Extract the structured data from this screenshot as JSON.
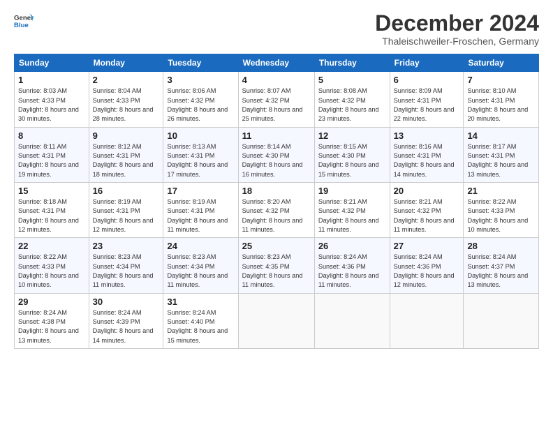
{
  "header": {
    "logo_line1": "General",
    "logo_line2": "Blue",
    "month": "December 2024",
    "location": "Thaleischweiler-Froschen, Germany"
  },
  "weekdays": [
    "Sunday",
    "Monday",
    "Tuesday",
    "Wednesday",
    "Thursday",
    "Friday",
    "Saturday"
  ],
  "weeks": [
    [
      {
        "day": "1",
        "sunrise": "Sunrise: 8:03 AM",
        "sunset": "Sunset: 4:33 PM",
        "daylight": "Daylight: 8 hours and 30 minutes."
      },
      {
        "day": "2",
        "sunrise": "Sunrise: 8:04 AM",
        "sunset": "Sunset: 4:33 PM",
        "daylight": "Daylight: 8 hours and 28 minutes."
      },
      {
        "day": "3",
        "sunrise": "Sunrise: 8:06 AM",
        "sunset": "Sunset: 4:32 PM",
        "daylight": "Daylight: 8 hours and 26 minutes."
      },
      {
        "day": "4",
        "sunrise": "Sunrise: 8:07 AM",
        "sunset": "Sunset: 4:32 PM",
        "daylight": "Daylight: 8 hours and 25 minutes."
      },
      {
        "day": "5",
        "sunrise": "Sunrise: 8:08 AM",
        "sunset": "Sunset: 4:32 PM",
        "daylight": "Daylight: 8 hours and 23 minutes."
      },
      {
        "day": "6",
        "sunrise": "Sunrise: 8:09 AM",
        "sunset": "Sunset: 4:31 PM",
        "daylight": "Daylight: 8 hours and 22 minutes."
      },
      {
        "day": "7",
        "sunrise": "Sunrise: 8:10 AM",
        "sunset": "Sunset: 4:31 PM",
        "daylight": "Daylight: 8 hours and 20 minutes."
      }
    ],
    [
      {
        "day": "8",
        "sunrise": "Sunrise: 8:11 AM",
        "sunset": "Sunset: 4:31 PM",
        "daylight": "Daylight: 8 hours and 19 minutes."
      },
      {
        "day": "9",
        "sunrise": "Sunrise: 8:12 AM",
        "sunset": "Sunset: 4:31 PM",
        "daylight": "Daylight: 8 hours and 18 minutes."
      },
      {
        "day": "10",
        "sunrise": "Sunrise: 8:13 AM",
        "sunset": "Sunset: 4:31 PM",
        "daylight": "Daylight: 8 hours and 17 minutes."
      },
      {
        "day": "11",
        "sunrise": "Sunrise: 8:14 AM",
        "sunset": "Sunset: 4:30 PM",
        "daylight": "Daylight: 8 hours and 16 minutes."
      },
      {
        "day": "12",
        "sunrise": "Sunrise: 8:15 AM",
        "sunset": "Sunset: 4:30 PM",
        "daylight": "Daylight: 8 hours and 15 minutes."
      },
      {
        "day": "13",
        "sunrise": "Sunrise: 8:16 AM",
        "sunset": "Sunset: 4:31 PM",
        "daylight": "Daylight: 8 hours and 14 minutes."
      },
      {
        "day": "14",
        "sunrise": "Sunrise: 8:17 AM",
        "sunset": "Sunset: 4:31 PM",
        "daylight": "Daylight: 8 hours and 13 minutes."
      }
    ],
    [
      {
        "day": "15",
        "sunrise": "Sunrise: 8:18 AM",
        "sunset": "Sunset: 4:31 PM",
        "daylight": "Daylight: 8 hours and 12 minutes."
      },
      {
        "day": "16",
        "sunrise": "Sunrise: 8:19 AM",
        "sunset": "Sunset: 4:31 PM",
        "daylight": "Daylight: 8 hours and 12 minutes."
      },
      {
        "day": "17",
        "sunrise": "Sunrise: 8:19 AM",
        "sunset": "Sunset: 4:31 PM",
        "daylight": "Daylight: 8 hours and 11 minutes."
      },
      {
        "day": "18",
        "sunrise": "Sunrise: 8:20 AM",
        "sunset": "Sunset: 4:32 PM",
        "daylight": "Daylight: 8 hours and 11 minutes."
      },
      {
        "day": "19",
        "sunrise": "Sunrise: 8:21 AM",
        "sunset": "Sunset: 4:32 PM",
        "daylight": "Daylight: 8 hours and 11 minutes."
      },
      {
        "day": "20",
        "sunrise": "Sunrise: 8:21 AM",
        "sunset": "Sunset: 4:32 PM",
        "daylight": "Daylight: 8 hours and 11 minutes."
      },
      {
        "day": "21",
        "sunrise": "Sunrise: 8:22 AM",
        "sunset": "Sunset: 4:33 PM",
        "daylight": "Daylight: 8 hours and 10 minutes."
      }
    ],
    [
      {
        "day": "22",
        "sunrise": "Sunrise: 8:22 AM",
        "sunset": "Sunset: 4:33 PM",
        "daylight": "Daylight: 8 hours and 10 minutes."
      },
      {
        "day": "23",
        "sunrise": "Sunrise: 8:23 AM",
        "sunset": "Sunset: 4:34 PM",
        "daylight": "Daylight: 8 hours and 11 minutes."
      },
      {
        "day": "24",
        "sunrise": "Sunrise: 8:23 AM",
        "sunset": "Sunset: 4:34 PM",
        "daylight": "Daylight: 8 hours and 11 minutes."
      },
      {
        "day": "25",
        "sunrise": "Sunrise: 8:23 AM",
        "sunset": "Sunset: 4:35 PM",
        "daylight": "Daylight: 8 hours and 11 minutes."
      },
      {
        "day": "26",
        "sunrise": "Sunrise: 8:24 AM",
        "sunset": "Sunset: 4:36 PM",
        "daylight": "Daylight: 8 hours and 11 minutes."
      },
      {
        "day": "27",
        "sunrise": "Sunrise: 8:24 AM",
        "sunset": "Sunset: 4:36 PM",
        "daylight": "Daylight: 8 hours and 12 minutes."
      },
      {
        "day": "28",
        "sunrise": "Sunrise: 8:24 AM",
        "sunset": "Sunset: 4:37 PM",
        "daylight": "Daylight: 8 hours and 13 minutes."
      }
    ],
    [
      {
        "day": "29",
        "sunrise": "Sunrise: 8:24 AM",
        "sunset": "Sunset: 4:38 PM",
        "daylight": "Daylight: 8 hours and 13 minutes."
      },
      {
        "day": "30",
        "sunrise": "Sunrise: 8:24 AM",
        "sunset": "Sunset: 4:39 PM",
        "daylight": "Daylight: 8 hours and 14 minutes."
      },
      {
        "day": "31",
        "sunrise": "Sunrise: 8:24 AM",
        "sunset": "Sunset: 4:40 PM",
        "daylight": "Daylight: 8 hours and 15 minutes."
      },
      null,
      null,
      null,
      null
    ]
  ]
}
